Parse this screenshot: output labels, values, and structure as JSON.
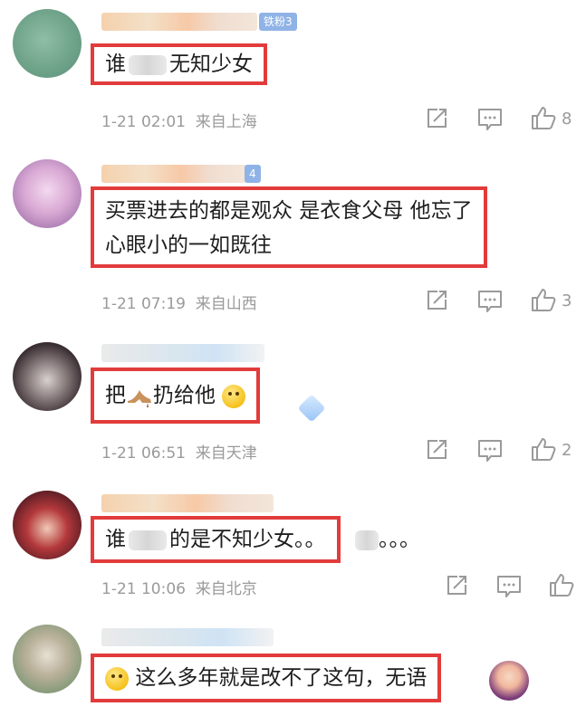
{
  "comments": [
    {
      "badge": "铁粉3",
      "text_before": "谁",
      "text_after": "无知少女",
      "time": "1-21 02:01",
      "location": "来自上海",
      "likes": "8"
    },
    {
      "badge": "4",
      "line1": "买票进去的都是观众  是衣食父母  他忘了",
      "line2": "心眼小的一如既往",
      "time": "1-21 07:19",
      "location": "来自山西",
      "likes": "3"
    },
    {
      "text_before": "把",
      "text_after": "扔给他",
      "time": "1-21 06:51",
      "location": "来自天津",
      "likes": "2"
    },
    {
      "text_before": "谁",
      "text_after": "的是不知少女。。",
      "trailing": "。。。",
      "time": "1-21 10:06",
      "location": "来自北京",
      "likes": ""
    },
    {
      "text": "这么多年就是改不了这句，无语"
    }
  ],
  "icons": {
    "share": "share-icon",
    "comment": "comment-icon",
    "like": "thumbs-up-icon"
  },
  "colors": {
    "highlight_border": "#e23b3b",
    "meta_text": "#9a9a9a",
    "badge": "#8fb3e6"
  }
}
